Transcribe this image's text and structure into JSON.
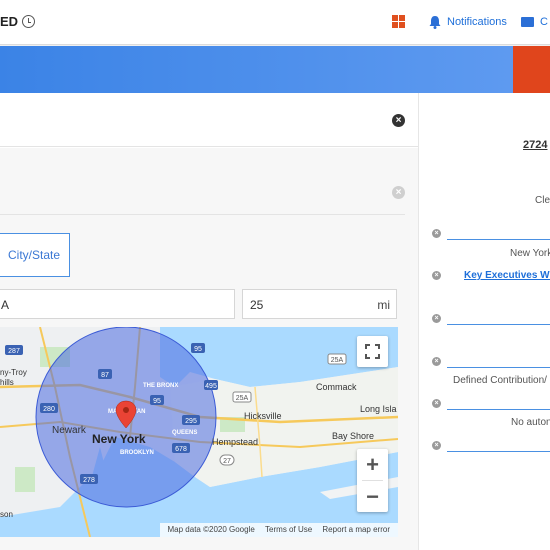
{
  "header": {
    "brand_fragment": "ED",
    "windows_icon": "windows-icon",
    "notifications_label": "Notifications",
    "mail_label_fragment": "C",
    "colors": {
      "link": "#1e6fd9",
      "windows": "#e0501f",
      "banner": "#4a8ceb",
      "banner_accent": "#e0451c"
    }
  },
  "panel": {
    "close_icon": "close-icon",
    "tab_city_state": "City/State",
    "location_value": "A",
    "distance_value": "25",
    "distance_unit": "mi"
  },
  "map": {
    "center_label": "New York",
    "labels": [
      "Newark",
      "BROOKLYN",
      "QUEENS",
      "THE BRONX",
      "MANHATTAN",
      "Hicksville",
      "Hempstead",
      "Commack",
      "Long Isla",
      "Bay Shore",
      "ny-Troy",
      "hills",
      "son"
    ],
    "shields": [
      "287",
      "95",
      "87",
      "280",
      "95",
      "295",
      "678",
      "278",
      "25A",
      "25A",
      "495",
      "27"
    ],
    "attribution": [
      "Map data ©2020 Google",
      "Terms of Use",
      "Report a map error"
    ],
    "radius_miles": 25
  },
  "right_panel": {
    "address_fragment": "2724",
    "line1": "Clea",
    "line2": "New York",
    "link_key_exec": "Key Executives With",
    "line3": "Defined Contribution/",
    "line4": "No auton"
  }
}
